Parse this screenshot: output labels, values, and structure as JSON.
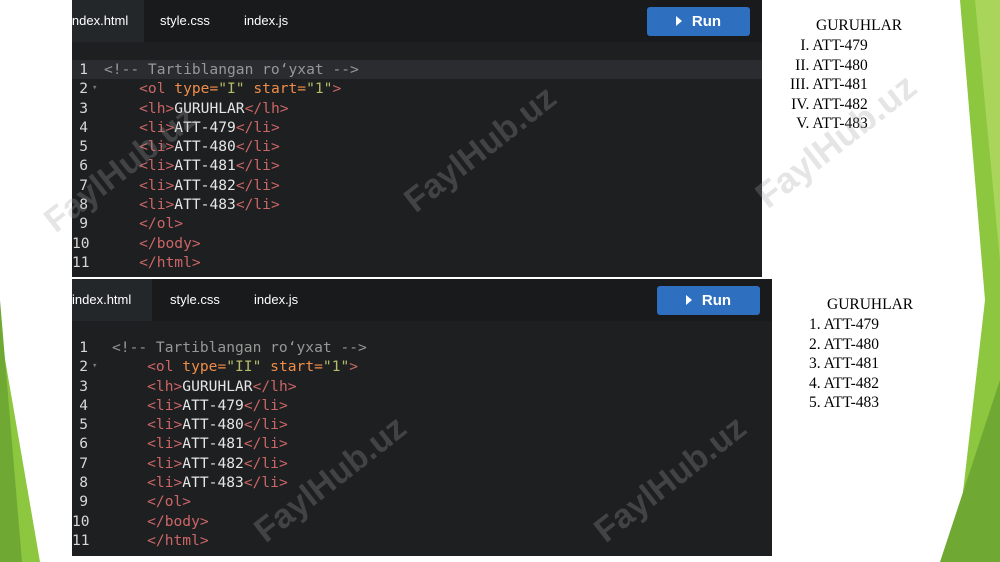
{
  "panel_top": {
    "tabs": [
      {
        "label": "index.html",
        "active": true
      },
      {
        "label": "style.css",
        "active": false
      },
      {
        "label": "index.js",
        "active": false
      }
    ],
    "run_label": "Run",
    "code_lines": [
      {
        "n": "1",
        "tokens": [
          {
            "t": "<!-- Tartiblangan ro‘yxat -->",
            "c": "comment"
          }
        ]
      },
      {
        "n": "2",
        "tokens": [
          {
            "t": "    <ol ",
            "c": "punct"
          },
          {
            "t": "type=",
            "c": "attr"
          },
          {
            "t": "\"I\"",
            "c": "str"
          },
          {
            "t": " start=",
            "c": "attr"
          },
          {
            "t": "\"1\"",
            "c": "str"
          },
          {
            "t": ">",
            "c": "punct"
          }
        ]
      },
      {
        "n": "3",
        "tokens": [
          {
            "t": "    <lh>",
            "c": "punct"
          },
          {
            "t": "GURUHLAR",
            "c": "text"
          },
          {
            "t": "</lh>",
            "c": "punct"
          }
        ]
      },
      {
        "n": "4",
        "tokens": [
          {
            "t": "    <li>",
            "c": "punct"
          },
          {
            "t": "ATT-479",
            "c": "text"
          },
          {
            "t": "</li>",
            "c": "punct"
          }
        ]
      },
      {
        "n": "5",
        "tokens": [
          {
            "t": "    <li>",
            "c": "punct"
          },
          {
            "t": "ATT-480",
            "c": "text"
          },
          {
            "t": "</li>",
            "c": "punct"
          }
        ]
      },
      {
        "n": "6",
        "tokens": [
          {
            "t": "    <li>",
            "c": "punct"
          },
          {
            "t": "ATT-481",
            "c": "text"
          },
          {
            "t": "</li>",
            "c": "punct"
          }
        ]
      },
      {
        "n": "7",
        "tokens": [
          {
            "t": "    <li>",
            "c": "punct"
          },
          {
            "t": "ATT-482",
            "c": "text"
          },
          {
            "t": "</li>",
            "c": "punct"
          }
        ]
      },
      {
        "n": "8",
        "tokens": [
          {
            "t": "    <li>",
            "c": "punct"
          },
          {
            "t": "ATT-483",
            "c": "text"
          },
          {
            "t": "</li>",
            "c": "punct"
          }
        ]
      },
      {
        "n": "9",
        "tokens": [
          {
            "t": "    </ol>",
            "c": "punct"
          }
        ]
      },
      {
        "n": "10",
        "tokens": [
          {
            "t": "    </body>",
            "c": "punct"
          }
        ]
      },
      {
        "n": "11",
        "tokens": [
          {
            "t": "    </html>",
            "c": "punct"
          }
        ]
      }
    ],
    "output": {
      "title": "GURUHLAR",
      "items": [
        "I. ATT-479",
        "II. ATT-480",
        "III. ATT-481",
        "IV. ATT-482",
        "V. ATT-483"
      ]
    }
  },
  "panel_bottom": {
    "tabs": [
      {
        "label": "index.html",
        "active": true
      },
      {
        "label": "style.css",
        "active": false
      },
      {
        "label": "index.js",
        "active": false
      }
    ],
    "run_label": "Run",
    "code_lines": [
      {
        "n": "1",
        "tokens": [
          {
            "t": "<!-- Tartiblangan ro‘yxat -->",
            "c": "comment"
          }
        ]
      },
      {
        "n": "2",
        "tokens": [
          {
            "t": "    <ol ",
            "c": "punct"
          },
          {
            "t": "type=",
            "c": "attr"
          },
          {
            "t": "\"II\"",
            "c": "str"
          },
          {
            "t": " start=",
            "c": "attr"
          },
          {
            "t": "\"1\"",
            "c": "str"
          },
          {
            "t": ">",
            "c": "punct"
          }
        ]
      },
      {
        "n": "3",
        "tokens": [
          {
            "t": "    <lh>",
            "c": "punct"
          },
          {
            "t": "GURUHLAR",
            "c": "text"
          },
          {
            "t": "</lh>",
            "c": "punct"
          }
        ]
      },
      {
        "n": "4",
        "tokens": [
          {
            "t": "    <li>",
            "c": "punct"
          },
          {
            "t": "ATT-479",
            "c": "text"
          },
          {
            "t": "</li>",
            "c": "punct"
          }
        ]
      },
      {
        "n": "5",
        "tokens": [
          {
            "t": "    <li>",
            "c": "punct"
          },
          {
            "t": "ATT-480",
            "c": "text"
          },
          {
            "t": "</li>",
            "c": "punct"
          }
        ]
      },
      {
        "n": "6",
        "tokens": [
          {
            "t": "    <li>",
            "c": "punct"
          },
          {
            "t": "ATT-481",
            "c": "text"
          },
          {
            "t": "</li>",
            "c": "punct"
          }
        ]
      },
      {
        "n": "7",
        "tokens": [
          {
            "t": "    <li>",
            "c": "punct"
          },
          {
            "t": "ATT-482",
            "c": "text"
          },
          {
            "t": "</li>",
            "c": "punct"
          }
        ]
      },
      {
        "n": "8",
        "tokens": [
          {
            "t": "    <li>",
            "c": "punct"
          },
          {
            "t": "ATT-483",
            "c": "text"
          },
          {
            "t": "</li>",
            "c": "punct"
          }
        ]
      },
      {
        "n": "9",
        "tokens": [
          {
            "t": "    </ol>",
            "c": "punct"
          }
        ]
      },
      {
        "n": "10",
        "tokens": [
          {
            "t": "    </body>",
            "c": "punct"
          }
        ]
      },
      {
        "n": "11",
        "tokens": [
          {
            "t": "    </html>",
            "c": "punct"
          }
        ]
      }
    ],
    "output": {
      "title": "GURUHLAR",
      "items": [
        "1. ATT-479",
        "2. ATT-480",
        "3. ATT-481",
        "4. ATT-482",
        "5. ATT-483"
      ]
    }
  },
  "watermark": "FaylHub.uz",
  "colors": {
    "editor_bg": "#1d1f21",
    "tab_bar": "#181a1b",
    "run_button": "#2f6fc0",
    "slide_green": "#8dc63f"
  }
}
